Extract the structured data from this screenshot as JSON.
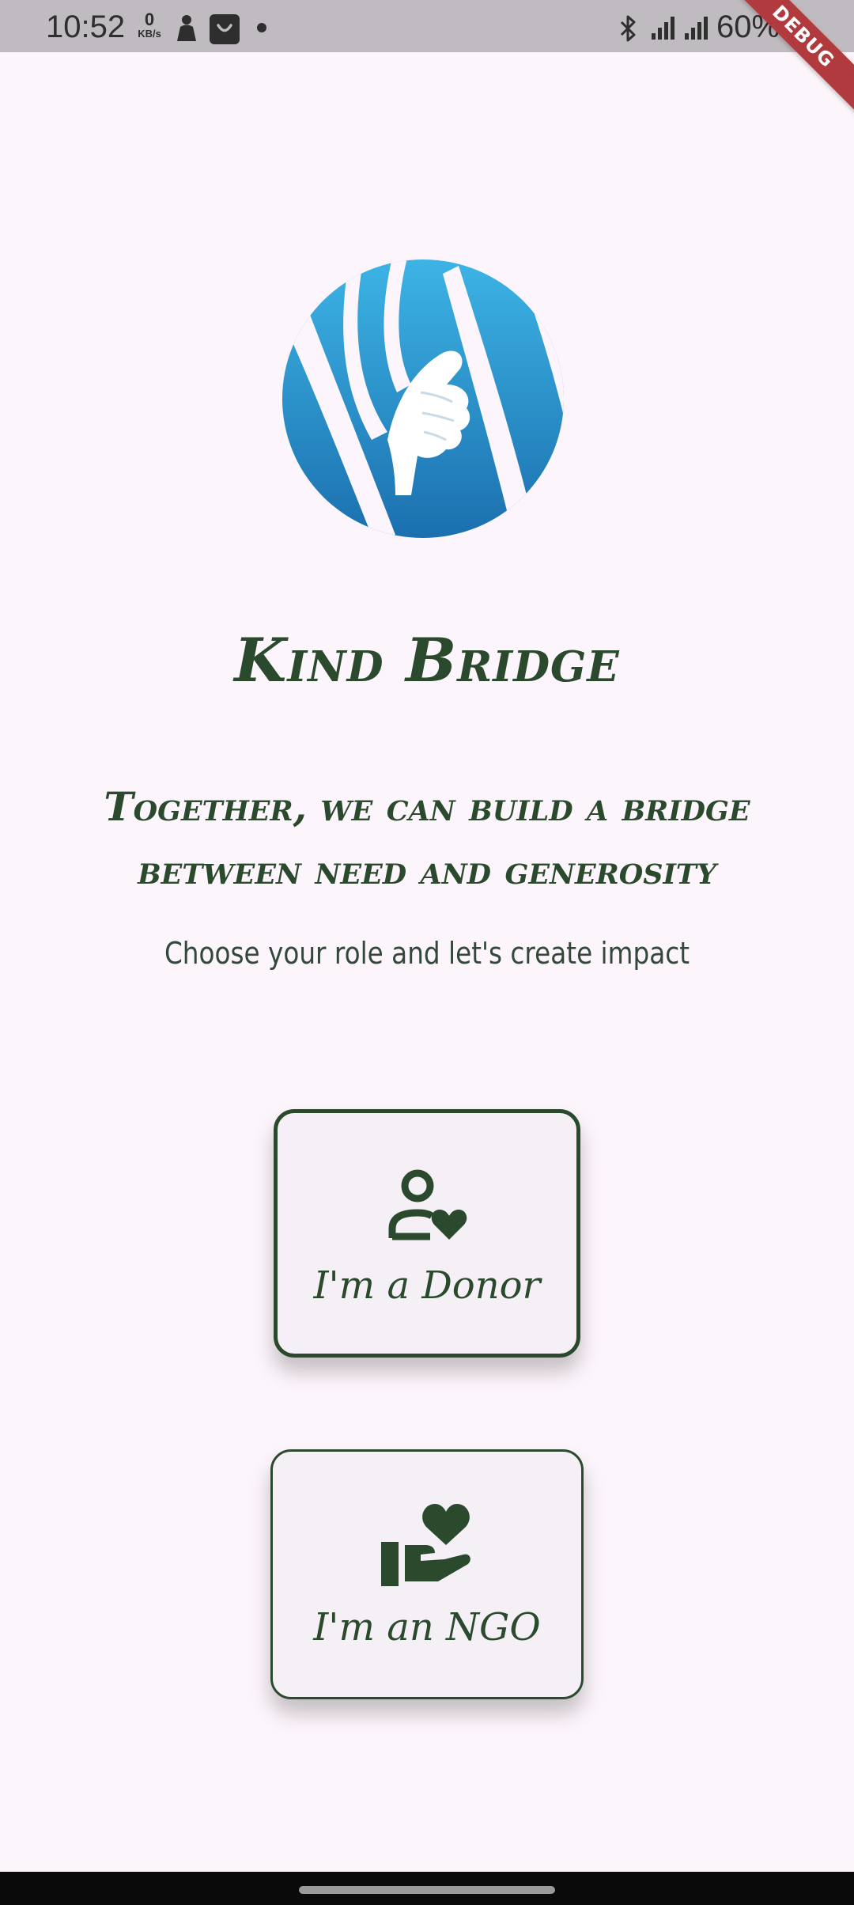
{
  "status_bar": {
    "time": "10:52",
    "net_speed_value": "0",
    "net_speed_unit": "KB/s",
    "battery_percent": "60%",
    "icons": [
      "person-icon",
      "shopping-bag-icon",
      "dot-icon",
      "bluetooth-icon",
      "signal-icon",
      "signal-icon",
      "battery-icon"
    ]
  },
  "debug_banner": "DEBUG",
  "app": {
    "title": "Kind Bridge",
    "tagline": "Together, we can build a bridge between need and generosity",
    "subtitle": "Choose your role and let's create impact"
  },
  "roles": {
    "donor": {
      "label": "I'm a Donor",
      "icon": "donor-person-heart-icon"
    },
    "ngo": {
      "label": "I'm an NGO",
      "icon": "hand-heart-icon"
    }
  },
  "colors": {
    "primary_green": "#2b4a2d",
    "background": "#fcf5fb",
    "card_background": "#f4f0f5",
    "logo_blue": "#2a8fcf"
  }
}
